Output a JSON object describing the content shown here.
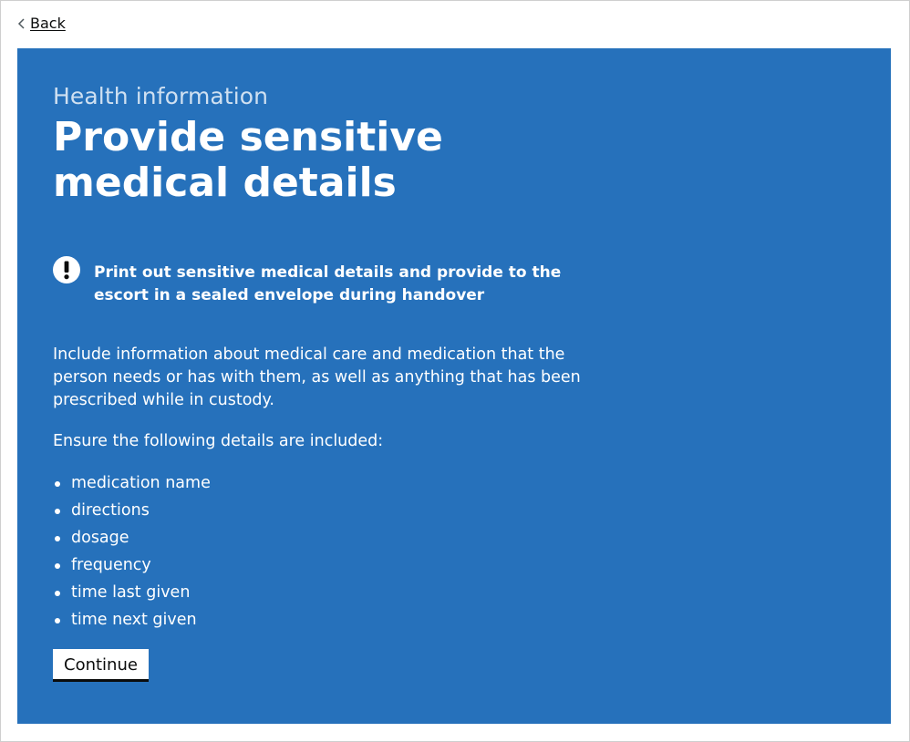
{
  "nav": {
    "back_label": "Back",
    "back_icon": "chevron-left-icon"
  },
  "panel": {
    "background_color": "#2671bb",
    "caption": "Health information",
    "title": "Provide sensitive medical details",
    "warning": {
      "icon": "exclamation-icon",
      "text": "Print out sensitive medical details and provide to the escort in a sealed envelope during handover"
    },
    "intro": "Include information about medical care and medication that the person needs or has with them, as well as anything that has been prescribed while in custody.",
    "ensure_label": "Ensure the following details are included:",
    "details": [
      "medication name",
      "directions",
      "dosage",
      "frequency",
      "time last given",
      "time next given"
    ],
    "continue_label": "Continue"
  }
}
